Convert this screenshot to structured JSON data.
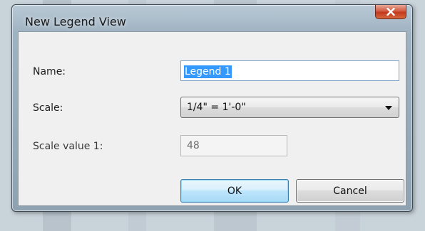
{
  "window": {
    "title": "New Legend View",
    "close_glyph": "x"
  },
  "form": {
    "name": {
      "label": "Name:",
      "value": "Legend 1"
    },
    "scale": {
      "label": "Scale:",
      "selected": "1/4\" = 1'-0\""
    },
    "scale_value": {
      "label": "Scale value  1:",
      "value": "48"
    }
  },
  "buttons": {
    "ok_label": "OK",
    "cancel_label": "Cancel"
  },
  "colors": {
    "accent": "#3399ff",
    "close_button": "#c2381c",
    "ok_button_border": "#3c7fb1"
  },
  "icons": {
    "close": "close-icon",
    "dropdown": "chevron-down-icon"
  }
}
